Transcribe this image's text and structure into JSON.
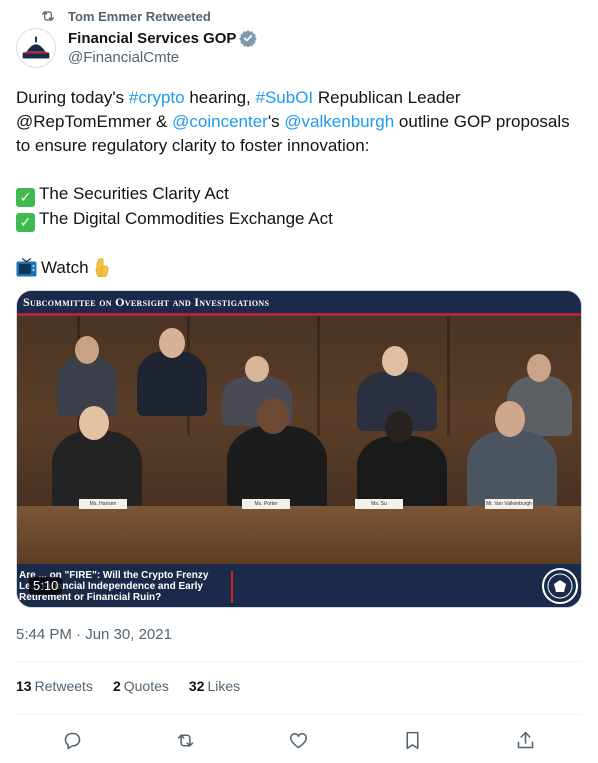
{
  "retweet": {
    "text": "Tom Emmer Retweeted"
  },
  "author": {
    "display_name": "Financial Services GOP",
    "handle": "@FinancialCmte",
    "verified_color": "#829aab"
  },
  "tweet": {
    "line1": {
      "t1": "During today's ",
      "l1": "#crypto",
      "t2": " hearing, ",
      "l2": "#SubOI",
      "t3": " Republican Leader"
    },
    "line2": {
      "t1": "@RepTomEmmer & ",
      "l1": "@coincenter",
      "t2": "'s ",
      "l2": "@valkenburgh",
      "t3": " outline GOP proposals"
    },
    "line3": "to ensure regulatory clarity to foster innovation:",
    "bullet1": "The Securities Clarity Act",
    "bullet2": "The Digital Commodities Exchange Act",
    "watch": "Watch",
    "link_color": "#1d9bf0"
  },
  "media": {
    "banner_title": "Subcommittee on Oversight and Investigations",
    "caption": "Are ... on \"FIRE\": Will the Crypto Frenzy Le... Financial Independence and Early Retirement or Financial Ruin?",
    "duration": "5:10",
    "nameplates": [
      "Ms. Hansen",
      "Ms. Porter",
      "Ms. Su",
      "Mr. Van Valkenburgh"
    ],
    "seal_text": "COMMITTEE ON FINANCIAL SERVICES"
  },
  "timestamp": "5:44 PM · Jun 30, 2021",
  "stats": {
    "retweets_count": "13",
    "retweets_label": "Retweets",
    "quotes_count": "2",
    "quotes_label": "Quotes",
    "likes_count": "32",
    "likes_label": "Likes"
  },
  "actions": [
    "reply-icon",
    "retweet-icon",
    "like-icon",
    "bookmark-icon",
    "share-icon"
  ]
}
